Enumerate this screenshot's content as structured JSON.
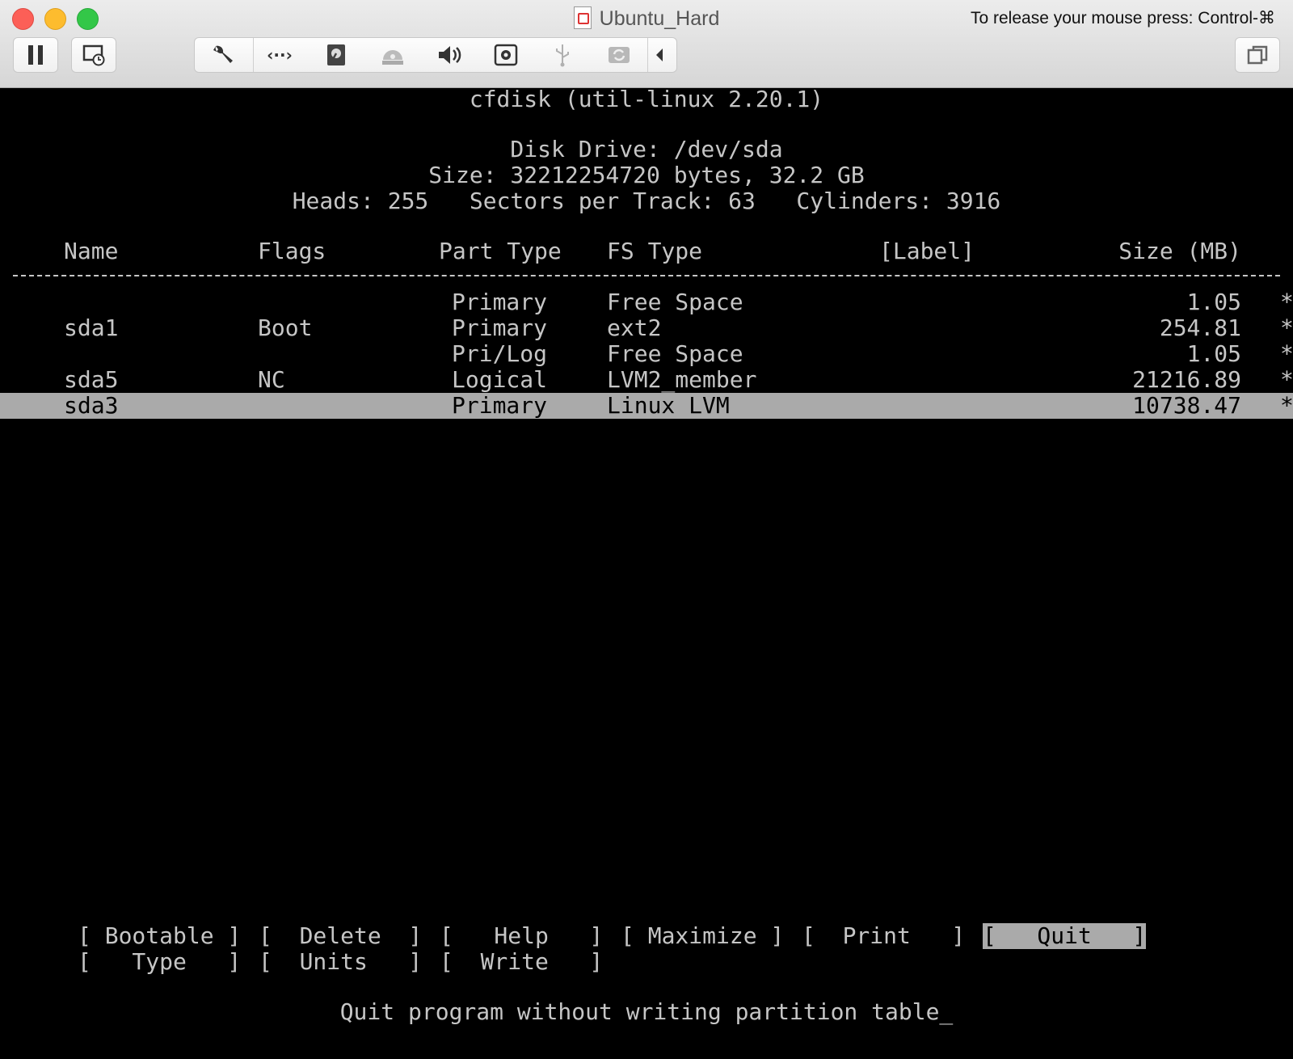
{
  "window": {
    "title": "Ubuntu_Hard",
    "release_hint": "To release your mouse press: Control-⌘"
  },
  "toolbar": {
    "icons": [
      "pause-icon",
      "snapshot-icon",
      "settings-wrench-icon",
      "network-icon",
      "hard-disk-icon",
      "cd-dvd-icon",
      "sound-icon",
      "camera-icon",
      "usb-icon",
      "shared-folders-icon",
      "collapse-arrow-icon",
      "fullscreen-icon"
    ]
  },
  "terminal": {
    "program_title": "cfdisk (util-linux 2.20.1)",
    "disk_drive": "Disk Drive: /dev/sda",
    "size_line": "Size: 32212254720 bytes, 32.2 GB",
    "geometry_line": "Heads: 255   Sectors per Track: 63   Cylinders: 3916",
    "columns": {
      "name": "Name",
      "flags": "Flags",
      "part_type": "Part Type",
      "fs_type": "FS Type",
      "label": "[Label]",
      "size": "Size (MB)"
    },
    "partitions": [
      {
        "name": "",
        "flags": "",
        "part_type": "Primary",
        "fs_type": "Free Space",
        "size": "1.05",
        "marker": "*"
      },
      {
        "name": "sda1",
        "flags": "Boot",
        "part_type": "Primary",
        "fs_type": "ext2",
        "size": "254.81",
        "marker": "*"
      },
      {
        "name": "",
        "flags": "",
        "part_type": "Pri/Log",
        "fs_type": "Free Space",
        "size": "1.05",
        "marker": "*"
      },
      {
        "name": "sda5",
        "flags": "NC",
        "part_type": "Logical",
        "fs_type": "LVM2_member",
        "size": "21216.89",
        "marker": "*"
      },
      {
        "name": "sda3",
        "flags": "",
        "part_type": "Primary",
        "fs_type": "Linux LVM",
        "size": "10738.47",
        "marker": "*",
        "selected": true
      }
    ],
    "menu": {
      "bootable": "[ Bootable ]",
      "delete": "[  Delete  ]",
      "help": "[   Help   ]",
      "maximize": "[ Maximize ]",
      "print": "[  Print   ]",
      "quit": "[   Quit   ]",
      "type": "[   Type   ]",
      "units": "[  Units   ]",
      "write": "[  Write   ]"
    },
    "selected_menu": "quit",
    "status": "Quit program without writing partition table_"
  }
}
